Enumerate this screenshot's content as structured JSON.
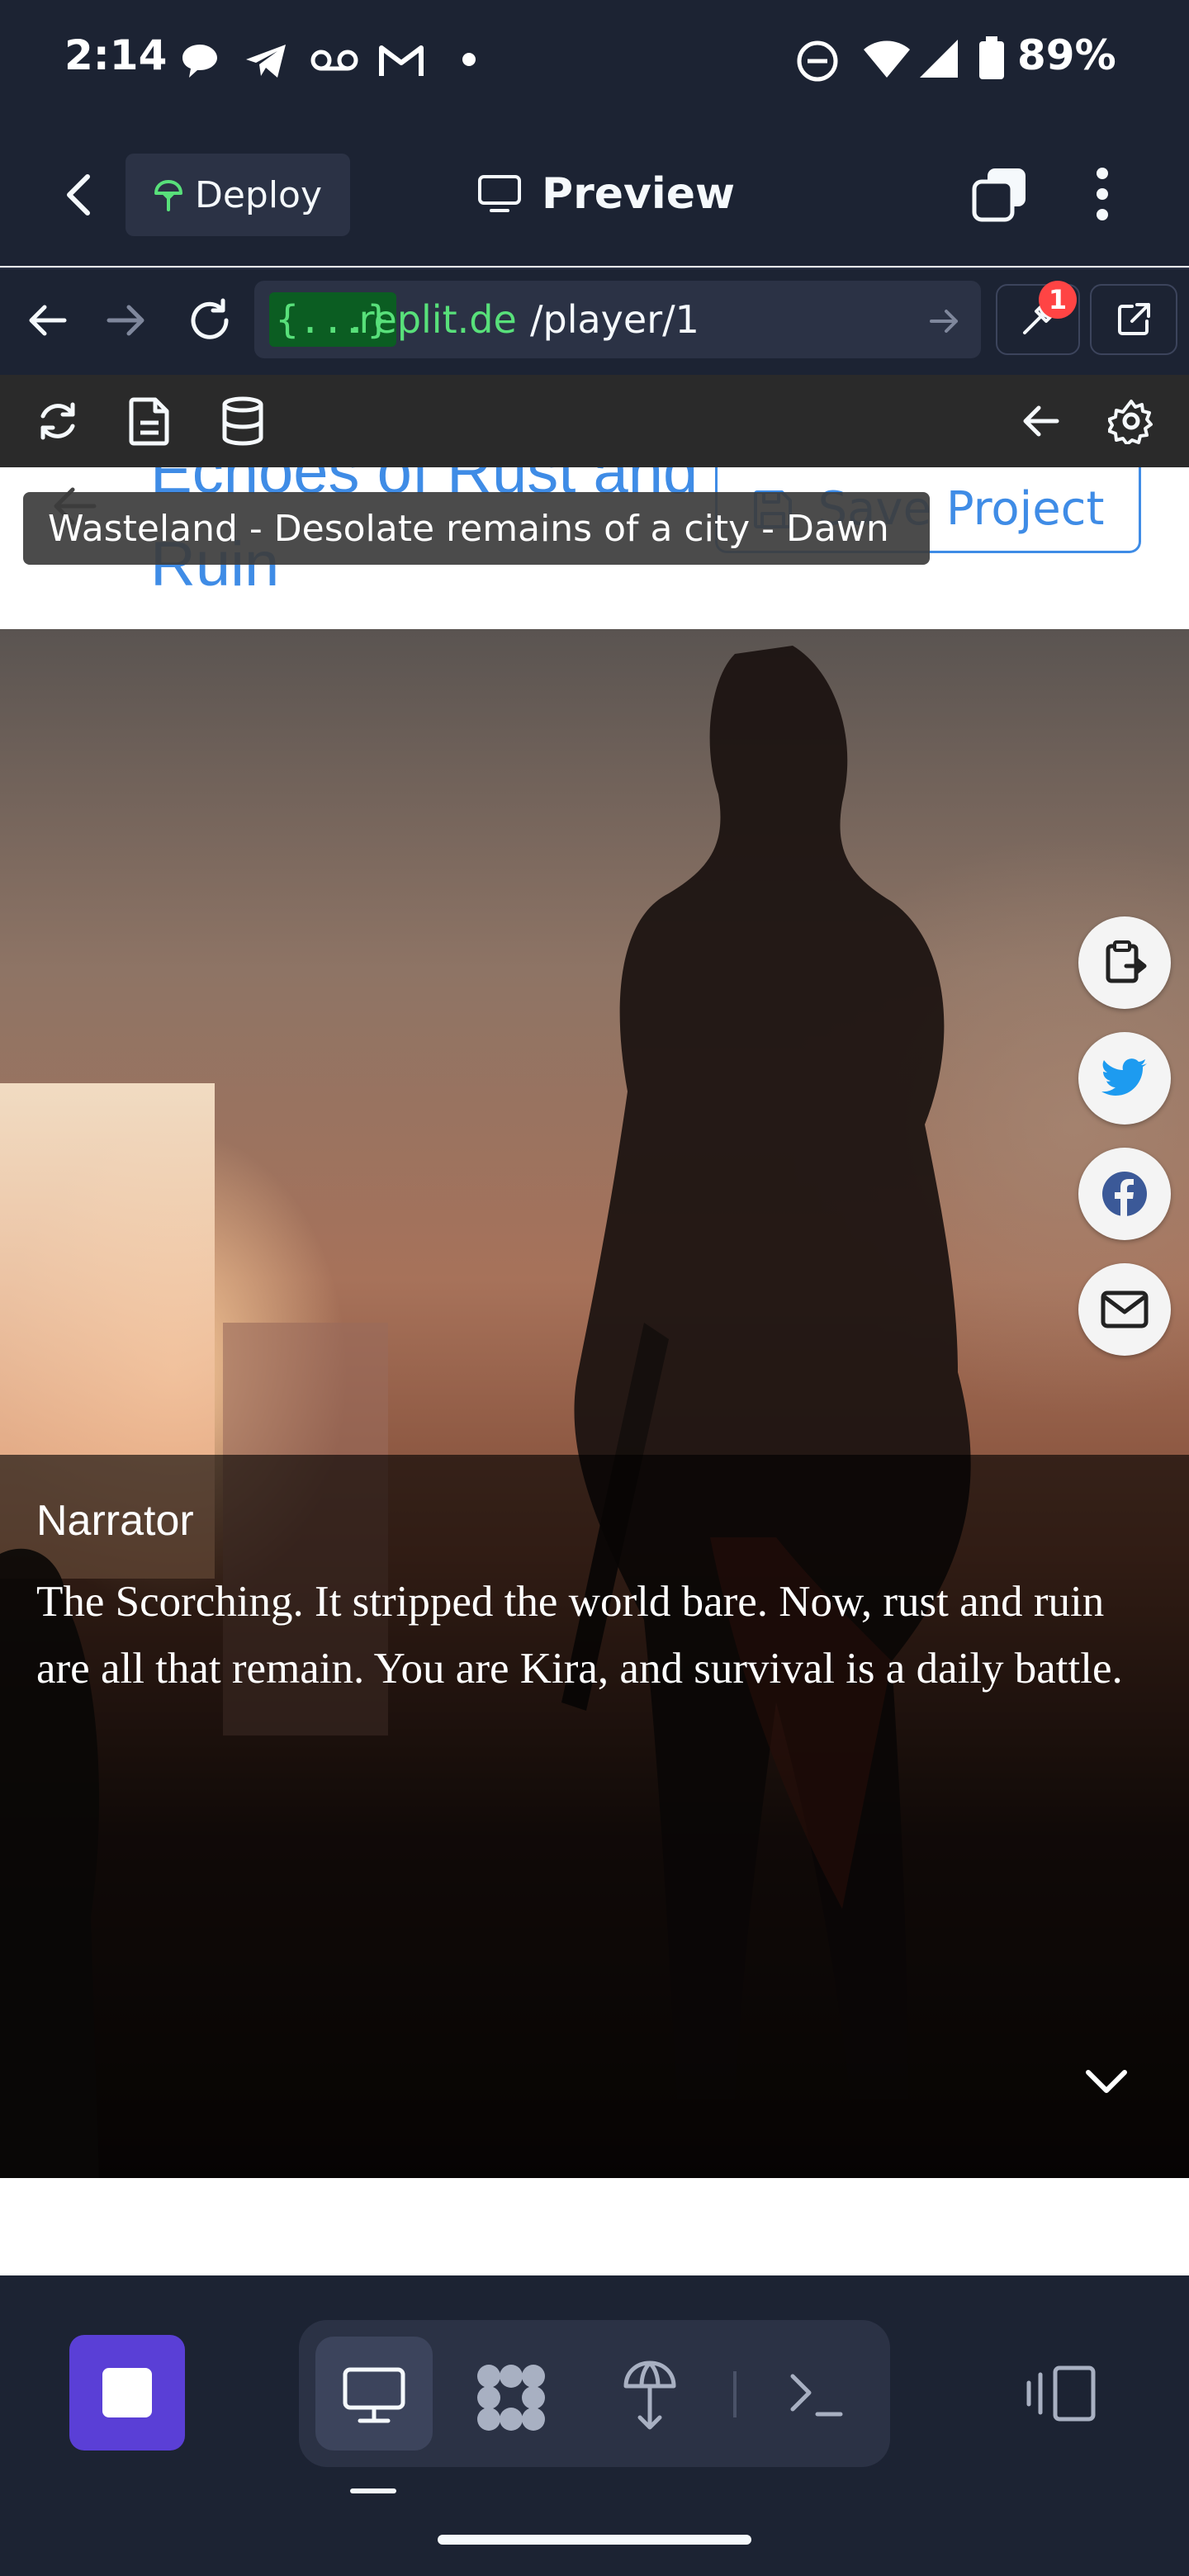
{
  "status_bar": {
    "time": "2:14",
    "battery": "89%",
    "icons": [
      "chat-bubble-icon",
      "telegram-icon",
      "voicemail-icon",
      "gmail-icon",
      "dot-icon",
      "do-not-disturb-icon",
      "wifi-icon",
      "signal-icon",
      "battery-icon"
    ]
  },
  "header": {
    "back_icon": "chevron-left-icon",
    "deploy_label": "Deploy",
    "preview_label": "Preview",
    "tabs_icon": "tabs-icon",
    "menu_icon": "more-vertical-icon"
  },
  "url_bar": {
    "host_badge": "{...}",
    "host": ".replit.de",
    "path": "/player/1",
    "devtools_badge": "1"
  },
  "dev_toolbar": {
    "left_icons": [
      "refresh-icon",
      "file-icon",
      "database-icon"
    ],
    "right_icons": [
      "arrow-left-icon",
      "gear-icon"
    ]
  },
  "page": {
    "story_title": "Echoes of Rust and Ruin",
    "save_label": "Save Project",
    "tooltip": "Wasteland - Desolate remains of a city - Dawn",
    "share_buttons": [
      "clipboard-icon",
      "twitter-icon",
      "facebook-icon",
      "mail-icon"
    ],
    "speaker": "Narrator",
    "dialog": "The Scorching. It stripped the world bare. Now, rust and ruin are all that remain. You are Kira, and survival is a daily battle."
  },
  "bottom_bar": {
    "icons": [
      "stop-icon",
      "monitor-icon",
      "apps-icon",
      "deploy-icon",
      "terminal-icon",
      "split-panel-icon"
    ]
  },
  "colors": {
    "replit_bg": "#1c2333",
    "replit_panel": "#2b3245",
    "accent_blue": "#3f8ce6",
    "stop_purple": "#5a3fd6"
  }
}
